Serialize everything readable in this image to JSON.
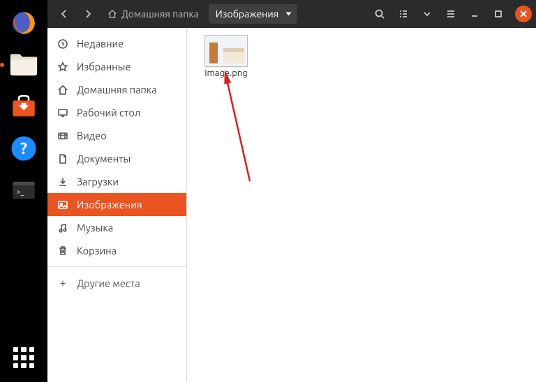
{
  "dock": {
    "items": [
      {
        "name": "firefox"
      },
      {
        "name": "files",
        "active": true
      },
      {
        "name": "software"
      },
      {
        "name": "help"
      },
      {
        "name": "terminal"
      }
    ]
  },
  "titlebar": {
    "breadcrumb": {
      "home_label": "Домашняя папка",
      "current_label": "Изображения"
    }
  },
  "sidebar": {
    "items": [
      {
        "icon": "recent",
        "label": "Недавние"
      },
      {
        "icon": "star",
        "label": "Избранные"
      },
      {
        "icon": "home",
        "label": "Домашняя папка"
      },
      {
        "icon": "desktop",
        "label": "Рабочий стол"
      },
      {
        "icon": "video",
        "label": "Видео"
      },
      {
        "icon": "documents",
        "label": "Документы"
      },
      {
        "icon": "downloads",
        "label": "Загрузки"
      },
      {
        "icon": "pictures",
        "label": "Изображения",
        "active": true
      },
      {
        "icon": "music",
        "label": "Музыка"
      },
      {
        "icon": "trash",
        "label": "Корзина"
      }
    ],
    "other_label": "Другие места"
  },
  "content": {
    "files": [
      {
        "name": "Image.png"
      }
    ]
  }
}
